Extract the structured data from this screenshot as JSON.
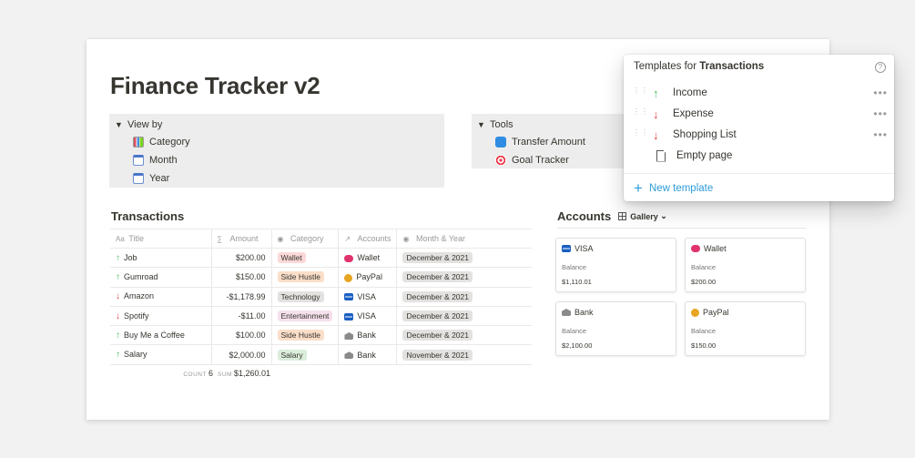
{
  "page": {
    "title": "Finance Tracker v2"
  },
  "view_by": {
    "label": "View by",
    "items": [
      {
        "label": "Category",
        "icon": "bar-chart-icon"
      },
      {
        "label": "Month",
        "icon": "calendar-icon"
      },
      {
        "label": "Year",
        "icon": "calendar-icon"
      }
    ]
  },
  "tools": {
    "label": "Tools",
    "items": [
      {
        "label": "Transfer Amount",
        "icon": "transfer-icon"
      },
      {
        "label": "Goal Tracker",
        "icon": "target-icon"
      }
    ]
  },
  "transactions": {
    "title": "Transactions",
    "headers": {
      "title": "Title",
      "amount": "Amount",
      "category": "Category",
      "accounts": "Accounts",
      "month": "Month & Year"
    },
    "header_icons": {
      "title": "Aa",
      "amount": "∑",
      "category": "◉",
      "accounts": "↗",
      "month": "◉"
    },
    "rows": [
      {
        "dir": "up",
        "title": "Job",
        "amount": "$200.00",
        "category": "Wallet",
        "cat_bg": "#fbd8d8",
        "account": "Wallet",
        "acc_icon": "wallet",
        "month": "December & 2021"
      },
      {
        "dir": "up",
        "title": "Gumroad",
        "amount": "$150.00",
        "category": "Side Hustle",
        "cat_bg": "#fadec9",
        "account": "PayPal",
        "acc_icon": "paypal",
        "month": "December & 2021"
      },
      {
        "dir": "down",
        "title": "Amazon",
        "amount": "-$1,178.99",
        "category": "Technology",
        "cat_bg": "#e3e2e0",
        "account": "VISA",
        "acc_icon": "visa",
        "month": "December & 2021"
      },
      {
        "dir": "down",
        "title": "Spotify",
        "amount": "-$11.00",
        "category": "Entertainment",
        "cat_bg": "#f5e0ec",
        "account": "VISA",
        "acc_icon": "visa",
        "month": "December & 2021"
      },
      {
        "dir": "up",
        "title": "Buy Me a Coffee",
        "amount": "$100.00",
        "category": "Side Hustle",
        "cat_bg": "#fadec9",
        "account": "Bank",
        "acc_icon": "bank",
        "month": "December & 2021"
      },
      {
        "dir": "up",
        "title": "Salary",
        "amount": "$2,000.00",
        "category": "Salary",
        "cat_bg": "#dbeddb",
        "account": "Bank",
        "acc_icon": "bank",
        "month": "November & 2021"
      }
    ],
    "footer": {
      "count_label": "COUNT",
      "count": "6",
      "sum_label": "SUM",
      "sum": "$1,260.01"
    }
  },
  "accounts": {
    "title": "Accounts",
    "view_label": "Gallery",
    "cards": [
      {
        "name": "VISA",
        "icon": "visa",
        "balance_label": "Balance",
        "balance": "$1,110.01"
      },
      {
        "name": "Wallet",
        "icon": "wallet",
        "balance_label": "Balance",
        "balance": "$200.00"
      },
      {
        "name": "Bank",
        "icon": "bank",
        "balance_label": "Balance",
        "balance": "$2,100.00"
      },
      {
        "name": "PayPal",
        "icon": "paypal",
        "balance_label": "Balance",
        "balance": "$150.00"
      }
    ]
  },
  "templates_popover": {
    "title_prefix": "Templates for ",
    "title_bold": "Transactions",
    "items": [
      {
        "label": "Income",
        "type": "up"
      },
      {
        "label": "Expense",
        "type": "down"
      },
      {
        "label": "Shopping List",
        "type": "down"
      },
      {
        "label": "Empty page",
        "type": "doc"
      }
    ],
    "new_label": "New template"
  },
  "colors": {
    "income": "#4dbd5c",
    "expense": "#e03e3e",
    "accent": "#2e9cd9"
  }
}
